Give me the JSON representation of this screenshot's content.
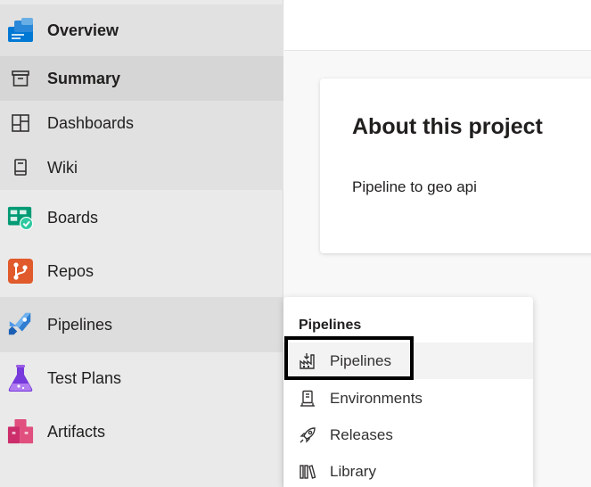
{
  "sidebar": {
    "items": [
      {
        "label": "Overview",
        "icon": "overview-icon"
      },
      {
        "label": "Summary",
        "icon": "summary-icon"
      },
      {
        "label": "Dashboards",
        "icon": "dashboards-icon"
      },
      {
        "label": "Wiki",
        "icon": "wiki-icon"
      },
      {
        "label": "Boards",
        "icon": "boards-icon"
      },
      {
        "label": "Repos",
        "icon": "repos-icon"
      },
      {
        "label": "Pipelines",
        "icon": "pipelines-icon"
      },
      {
        "label": "Test Plans",
        "icon": "test-plans-icon"
      },
      {
        "label": "Artifacts",
        "icon": "artifacts-icon"
      }
    ]
  },
  "card": {
    "title": "About this project",
    "description": "Pipeline to geo api"
  },
  "flyout": {
    "header": "Pipelines",
    "items": [
      {
        "label": "Pipelines",
        "icon": "pipelines-factory-icon"
      },
      {
        "label": "Environments",
        "icon": "environments-icon"
      },
      {
        "label": "Releases",
        "icon": "rocket-icon"
      },
      {
        "label": "Library",
        "icon": "library-icon"
      }
    ]
  },
  "colors": {
    "overview_blue": "#0078d4",
    "boards_green": "#009a74",
    "repos_orange": "#e05a2b",
    "test_purple": "#773adc",
    "artifacts_pink": "#cc2d6b",
    "highlight": "#000000"
  }
}
